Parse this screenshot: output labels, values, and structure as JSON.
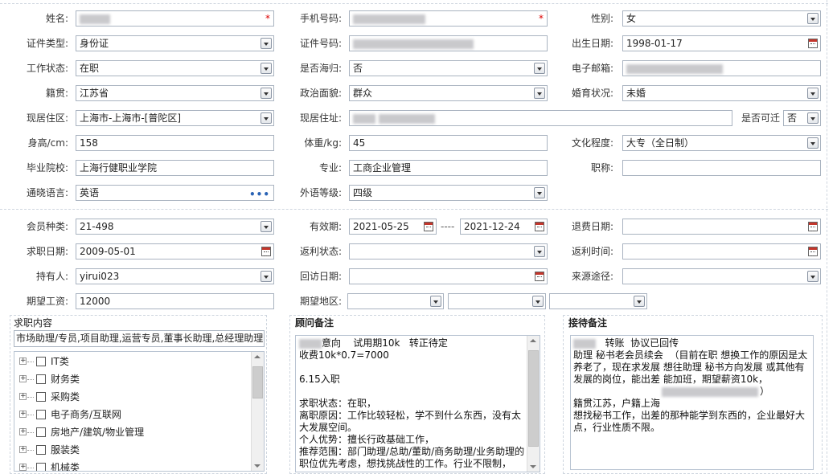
{
  "personal": {
    "name_label": "姓名:",
    "phone_label": "手机号码:",
    "gender_label": "性别:",
    "gender_value": "女",
    "idtype_label": "证件类型:",
    "idtype_value": "身份证",
    "idno_label": "证件号码:",
    "birth_label": "出生日期:",
    "birth_value": "1998-01-17",
    "workstatus_label": "工作状态:",
    "workstatus_value": "在职",
    "returnee_label": "是否海归:",
    "returnee_value": "否",
    "email_label": "电子邮箱:",
    "native_label": "籍贯:",
    "native_value": "江苏省",
    "political_label": "政治面貌:",
    "political_value": "群众",
    "marital_label": "婚育状况:",
    "marital_value": "未婚",
    "residence_label": "现居住区:",
    "residence_value": "上海市-上海市-[普陀区]",
    "address_label": "现居住址:",
    "relocate_label": "是否可迁",
    "relocate_value": "否",
    "height_label": "身高/cm:",
    "height_value": "158",
    "weight_label": "体重/kg:",
    "weight_value": "45",
    "education_label": "文化程度:",
    "education_value": "大专（全日制）",
    "school_label": "毕业院校:",
    "school_value": "上海行健职业学院",
    "major_label": "专业:",
    "major_value": "工商企业管理",
    "title_label": "职称:",
    "language_label": "通晓语言:",
    "language_value": "英语",
    "foreign_level_label": "外语等级:",
    "foreign_level_value": "四级",
    "required_mark": "*"
  },
  "membership": {
    "member_type_label": "会员种类:",
    "member_type_value": "21-498",
    "valid_label": "有效期:",
    "valid_from": "2021-05-25",
    "valid_sep": "----",
    "valid_to": "2021-12-24",
    "refund_date_label": "退费日期:",
    "jobseek_date_label": "求职日期:",
    "jobseek_date_value": "2009-05-01",
    "rebate_status_label": "返利状态:",
    "rebate_time_label": "返利时间:",
    "holder_label": "持有人:",
    "holder_value": "yirui023",
    "revisit_label": "回访日期:",
    "source_label": "来源途径:",
    "salary_label": "期望工资:",
    "salary_value": "12000",
    "region_label": "期望地区:"
  },
  "job_content": {
    "title": "求职内容",
    "summary": "市场助理/专员,项目助理,运营专员,董事长助理,总经理助理",
    "items": [
      {
        "label": "IT类"
      },
      {
        "label": "财务类"
      },
      {
        "label": "采购类"
      },
      {
        "label": "电子商务/互联网"
      },
      {
        "label": "房地产/建筑/物业管理"
      },
      {
        "label": "服装类"
      },
      {
        "label": "机械类"
      }
    ]
  },
  "advisor_notes": {
    "title": "顾问备注",
    "line1_tail": "意向    试用期10k   转正待定",
    "body": "收费10k*0.7=7000\n\n6.15入职\n\n求职状态：在职，\n离职原因：工作比较轻松，学不到什么东西，没有太大发展空间。\n个人优势：擅长行政基础工作，\n推荐范围：部门助理/总助/董助/商务助理/业务助理的职位优先考虑，想找挑战性的工作。行业不限制，"
  },
  "reception_notes": {
    "title": "接待备注",
    "line1_tail": "转账  协议已回传",
    "body_a": "助理 秘书老会员续会  （目前在职 想换工作的原因是太养老了，现在求发展 想往助理 秘书方向发展 或其他有发展的岗位，能出差 能加班，期望薪资10k，",
    "body_b": "）\n籍贯江苏，户籍上海\n想找秘书工作，出差的那种能学到东西的，企业最好大点，行业性质不限。"
  },
  "colors": {
    "border": "#a9b3c0",
    "required": "#dd0000",
    "calendar_red": "#c4362c",
    "more_dots": "#2a63b5"
  }
}
